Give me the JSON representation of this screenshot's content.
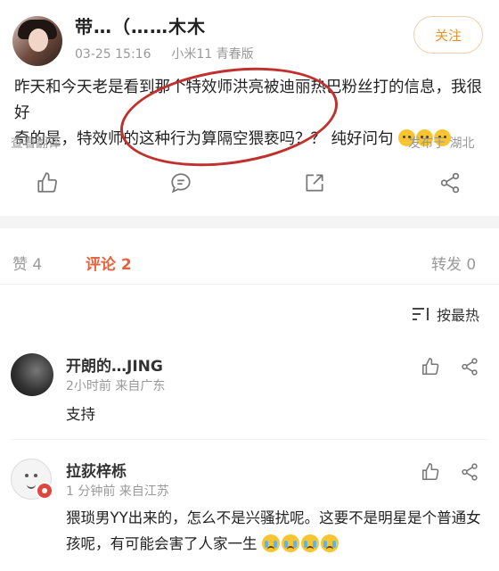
{
  "post": {
    "username": "带…（……木木",
    "time": "03-25 15:16",
    "device": "小米11 青春版",
    "follow_label": "关注",
    "body_line1": "昨天和今天老是看到那个特效师洪亮被迪丽热巴粉丝打的信息，我很好",
    "body_line2": "奇的是，特效师的这种行为算隔空猥亵吗？？ 纯好问句",
    "translate_label": "查看翻译",
    "location": "发布于 湖北"
  },
  "actions": {
    "like_icon": "thumbs-up-icon",
    "comment_icon": "comment-icon",
    "repost_icon": "share-icon",
    "more_icon": "more-share-icon"
  },
  "tabs": {
    "likes": "赞 4",
    "comments": "评论 2",
    "reposts": "转发 0"
  },
  "sort_label": "按最热",
  "comments": [
    {
      "name": "开朗的…JING",
      "meta": "2小时前  来自广东",
      "text": "支持"
    },
    {
      "name": "拉荻梓栎",
      "meta": "1 分钟前  来自江苏",
      "text_line1": "猥琐男YY出来的，怎么不是兴骚扰呢。这要不是明星是个普通女",
      "text_line2": "孩呢，有可能会害了人家一生"
    }
  ],
  "colors": {
    "accent_orange": "#e8912e",
    "tab_active": "#e8603c",
    "annotation_red": "#c0312e"
  }
}
